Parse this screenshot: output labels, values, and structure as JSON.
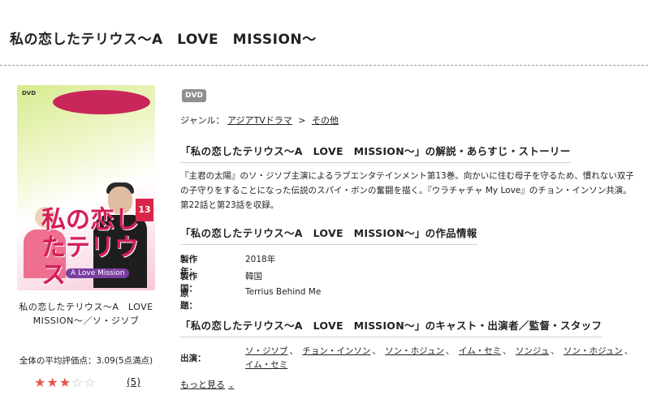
{
  "page": {
    "title": "私の恋したテリウス～A　LOVE　MISSION～"
  },
  "product": {
    "cover_alt": "私の恋したテリウス～A LOVE MISSION～",
    "cover_dvd_mark": "DVD",
    "cover_logo": "私の恋したテリウス",
    "cover_logo_sub": "A Love Mission",
    "cover_volume": "13",
    "left_title": "私の恋したテリウス～A　LOVE　MISSION～／ソ・ジソブ",
    "rating_label": "全体の平均評価点：3.09(5点満点)",
    "rating_value": 3.09,
    "rating_max": 5,
    "review_count": "(5)"
  },
  "badge": "DVD",
  "genre": {
    "label": "ジャンル：",
    "parent": "アジアTVドラマ",
    "separator": ">",
    "child": "その他"
  },
  "sections": {
    "story_heading": "「私の恋したテリウス～A　LOVE　MISSION～」の解説・あらすじ・ストーリー",
    "story_text": "『主君の太陽』のソ・ジソブ主演によるラブエンタテインメント第13巻。向かいに住む母子を守るため、慣れない双子の子守りをすることになった伝説のスパイ・ボンの奮闘を描く。『ウラチャチャ My Love』のチョン・インソン共演。第22話と第23話を収録。",
    "info_heading": "「私の恋したテリウス～A　LOVE　MISSION～」の作品情報",
    "cast_heading": "「私の恋したテリウス～A　LOVE　MISSION～」のキャスト・出演者／監督・スタッフ"
  },
  "info": [
    {
      "key": "製作年：",
      "value": "2018年"
    },
    {
      "key": "製作国：",
      "value": "韓国"
    },
    {
      "key": "原題：",
      "value": "Terrius Behind Me"
    }
  ],
  "cast": {
    "label": "出演：",
    "names": [
      "ソ・ジソブ",
      "チョン・インソン",
      "ソン・ホジュン",
      "イム・セミ",
      "ソンジュ",
      "ソン・ホジュン",
      "イム・セミ"
    ],
    "separator": "、"
  },
  "more_link": "もっと見る",
  "colors": {
    "star_on": "#e8574a",
    "star_off": "#bdbdbd",
    "badge_bg": "#8e8e8e"
  }
}
